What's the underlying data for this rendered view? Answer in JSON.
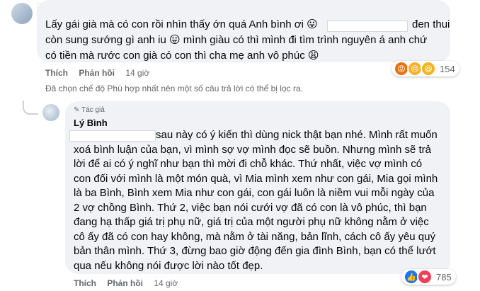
{
  "comment1": {
    "line1_pre": "Lấy gái già mà có con rồi nhìn thấy ớn quá Anh bình ơi 😛",
    "line1_post": "đen thui",
    "line2": "còn sung sướng gì anh iu 😛 mình giàu có thì mình đi tìm trình nguyên á anh chứ",
    "line3": "có tiền mà rước con già có con thì cha mẹ anh vô phúc 😩",
    "like_label": "Thích",
    "reply_label": "Phản hồi",
    "time": "14 giờ",
    "reaction_count": "154",
    "reactions": [
      "angry-icon",
      "sad-icon",
      "haha-icon"
    ]
  },
  "filter_notice": "Đã chọn chế độ Phù hợp nhất nên một số câu trả lời có thể bị lọc ra.",
  "reply": {
    "author_tag": "Tác giả",
    "author_name": "Lý Bình",
    "lines": [
      "sau này có ý kiến thì dùng nick thật bạn nhé. Mình rất muốn",
      "xoá bình luận của bạn, vì mình sợ vợ mình đọc sẽ buồn. Nhưng mình sẽ trả",
      "lời để ai có ý nghĩ như bạn thì mời đi chỗ khác. Thứ nhất, việc vợ mình có",
      "con đối với mình là một món quà, vì Mia mình xem như con gái, Mia gọi mình",
      "là ba Bình, Bình xem Mia như con gái, con gái luôn là niềm vui mỗi ngày của",
      "2 vợ chồng Bình. Thứ 2, việc bạn nói cưới vợ đã có con là vô phúc, thì bạn",
      "đang hạ thấp giá trị phụ nữ, giá trị của một người phụ nữ không nằm ở việc",
      "cô ấy đã có con hay không, mà nằm ở tài năng, bản lĩnh, cách cô ấy yêu quý",
      "bản thân mình. Thứ 3, đừng bao giờ động đến gia đình Bình, bạn có thể lướt",
      "qua nếu không nói được lời nào tốt đẹp."
    ],
    "like_label": "Thích",
    "reply_label": "Phản hồi",
    "time": "14 giờ",
    "reaction_count": "785",
    "reactions": [
      "like-icon",
      "love-icon"
    ]
  },
  "colors": {
    "bubble": "#f0f2f5",
    "meta": "#65676b",
    "like": "#1877f2",
    "love": "#f33e58",
    "angry": "#e9710f",
    "haha": "#f7b125"
  }
}
